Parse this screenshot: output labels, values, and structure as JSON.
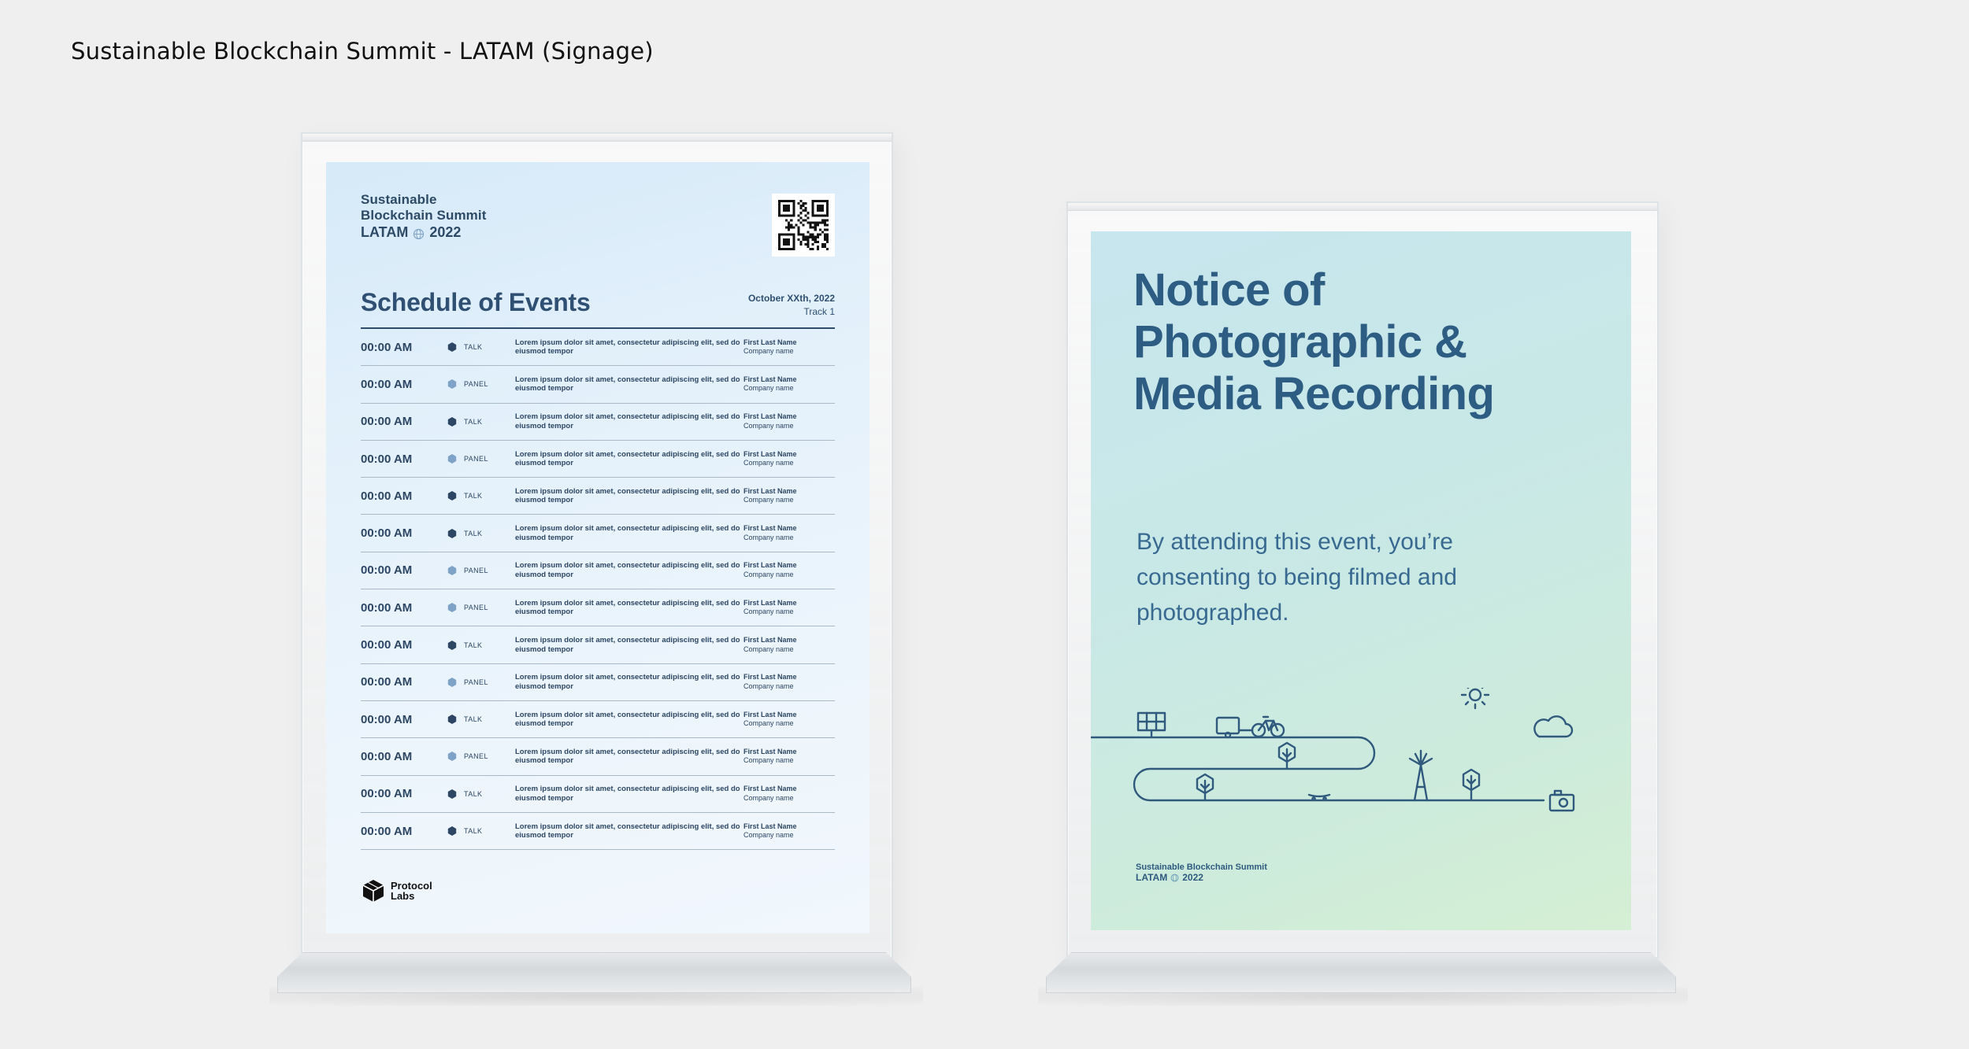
{
  "page_title": "Sustainable Blockchain Summit - LATAM (Signage)",
  "schedule_sign": {
    "brand": {
      "line1": "Sustainable",
      "line2": "Blockchain Summit",
      "latam": "LATAM",
      "year": "2022"
    },
    "title": "Schedule of Events",
    "date": "October XXth, 2022",
    "track": "Track 1",
    "rows": [
      {
        "time": "00:00 AM",
        "type": "TALK",
        "desc": "Lorem ipsum dolor sit amet, consectetur adipiscing elit, sed do eiusmod tempor",
        "speaker": "First Last Name",
        "company": "Company name"
      },
      {
        "time": "00:00 AM",
        "type": "PANEL",
        "desc": "Lorem ipsum dolor sit amet, consectetur adipiscing elit, sed do eiusmod tempor",
        "speaker": "First Last Name",
        "company": "Company name"
      },
      {
        "time": "00:00 AM",
        "type": "TALK",
        "desc": "Lorem ipsum dolor sit amet, consectetur adipiscing elit, sed do eiusmod tempor",
        "speaker": "First Last Name",
        "company": "Company name"
      },
      {
        "time": "00:00 AM",
        "type": "PANEL",
        "desc": "Lorem ipsum dolor sit amet, consectetur adipiscing elit, sed do eiusmod tempor",
        "speaker": "First Last Name",
        "company": "Company name"
      },
      {
        "time": "00:00 AM",
        "type": "TALK",
        "desc": "Lorem ipsum dolor sit amet, consectetur adipiscing elit, sed do eiusmod tempor",
        "speaker": "First Last Name",
        "company": "Company name"
      },
      {
        "time": "00:00 AM",
        "type": "TALK",
        "desc": "Lorem ipsum dolor sit amet, consectetur adipiscing elit, sed do eiusmod tempor",
        "speaker": "First Last Name",
        "company": "Company name"
      },
      {
        "time": "00:00 AM",
        "type": "PANEL",
        "desc": "Lorem ipsum dolor sit amet, consectetur adipiscing elit, sed do eiusmod tempor",
        "speaker": "First Last Name",
        "company": "Company name"
      },
      {
        "time": "00:00 AM",
        "type": "PANEL",
        "desc": "Lorem ipsum dolor sit amet, consectetur adipiscing elit, sed do eiusmod tempor",
        "speaker": "First Last Name",
        "company": "Company name"
      },
      {
        "time": "00:00 AM",
        "type": "TALK",
        "desc": "Lorem ipsum dolor sit amet, consectetur adipiscing elit, sed do eiusmod tempor",
        "speaker": "First Last Name",
        "company": "Company name"
      },
      {
        "time": "00:00 AM",
        "type": "PANEL",
        "desc": "Lorem ipsum dolor sit amet, consectetur adipiscing elit, sed do eiusmod tempor",
        "speaker": "First Last Name",
        "company": "Company name"
      },
      {
        "time": "00:00 AM",
        "type": "TALK",
        "desc": "Lorem ipsum dolor sit amet, consectetur adipiscing elit, sed do eiusmod tempor",
        "speaker": "First Last Name",
        "company": "Company name"
      },
      {
        "time": "00:00 AM",
        "type": "PANEL",
        "desc": "Lorem ipsum dolor sit amet, consectetur adipiscing elit, sed do eiusmod tempor",
        "speaker": "First Last Name",
        "company": "Company name"
      },
      {
        "time": "00:00 AM",
        "type": "TALK",
        "desc": "Lorem ipsum dolor sit amet, consectetur adipiscing elit, sed do eiusmod tempor",
        "speaker": "First Last Name",
        "company": "Company name"
      },
      {
        "time": "00:00 AM",
        "type": "TALK",
        "desc": "Lorem ipsum dolor sit amet, consectetur adipiscing elit, sed do eiusmod tempor",
        "speaker": "First Last Name",
        "company": "Company name"
      }
    ],
    "type_colors": {
      "TALK": "#2c4664",
      "PANEL": "#7fa3c6"
    },
    "sponsor_logo": {
      "line1": "Protocol",
      "line2": "Labs"
    }
  },
  "notice_sign": {
    "title": "Notice of Photographic & Media Recording",
    "body": "By attending this event, you’re consenting to being filmed and photographed.",
    "brand": {
      "line1": "Sustainable Blockchain Summit",
      "latam": "LATAM",
      "year": "2022"
    },
    "illustration_icons": [
      "solar-panel-icon",
      "trailer-icon",
      "bicycle-icon",
      "tree-icon",
      "wind-turbine-icon",
      "sun-icon",
      "cloud-icon",
      "camera-icon",
      "skateboard-icon"
    ]
  },
  "colors": {
    "background": "#efefef",
    "navy": "#2f5072",
    "notice_blue": "#2e5d83"
  }
}
